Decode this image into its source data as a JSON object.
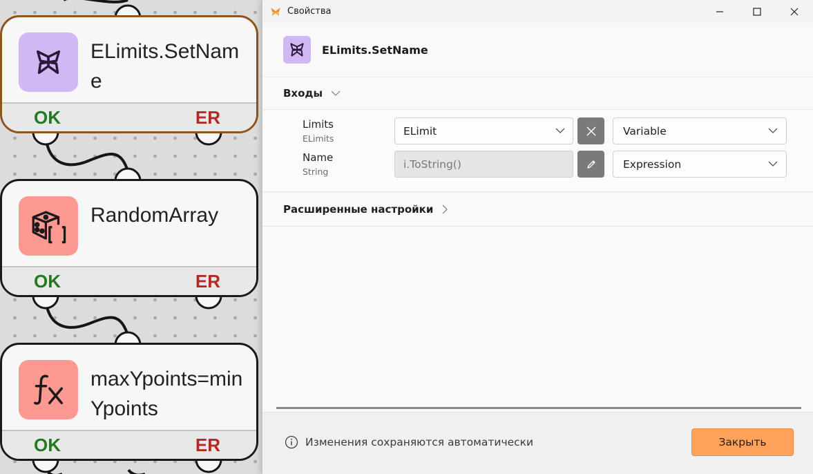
{
  "canvas": {
    "nodes": [
      {
        "title": "ELimits.SetName",
        "ok_label": "OK",
        "er_label": "ER",
        "icon": "butterfly-icon",
        "icon_color": "#d2b7f5",
        "selected": true
      },
      {
        "title": "RandomArray",
        "ok_label": "OK",
        "er_label": "ER",
        "icon": "dice-array-icon",
        "icon_color": "#fc9a92",
        "selected": false
      },
      {
        "title": "maxYpoints=minYpoints",
        "ok_label": "OK",
        "er_label": "ER",
        "icon": "function-icon",
        "icon_color": "#fc9a92",
        "selected": false
      }
    ]
  },
  "dialog": {
    "window_title": "Свойства",
    "header_title": "ELimits.SetName",
    "inputs_section": {
      "label": "Входы"
    },
    "params": [
      {
        "name": "Limits",
        "type": "ELimits",
        "value": "ELimit",
        "mode": "Variable",
        "action_icon": "clear-icon"
      },
      {
        "name": "Name",
        "type": "String",
        "value": "i.ToString()",
        "mode": "Expression",
        "action_icon": "edit-pencil-icon"
      }
    ],
    "advanced_section": {
      "label": "Расширенные настройки"
    },
    "footer": {
      "info_text": "Изменения сохраняются автоматически",
      "close_label": "Закрыть"
    }
  },
  "colors": {
    "accent": "#ffa25c",
    "ok": "#217a21",
    "er": "#b22a22",
    "selected_border": "#8e5419"
  }
}
